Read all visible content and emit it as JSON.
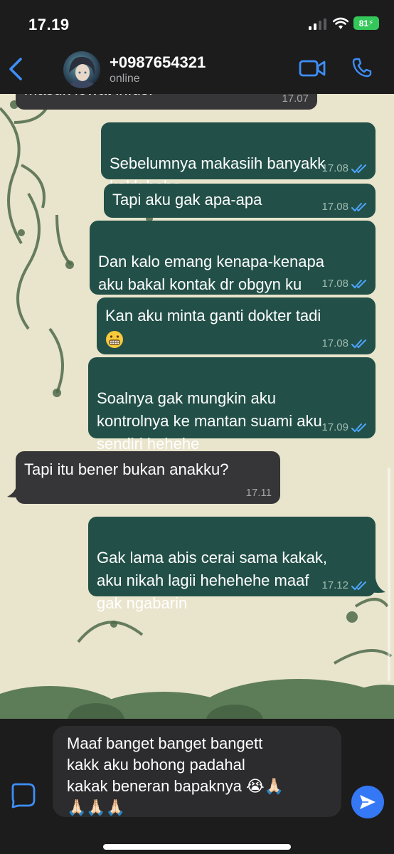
{
  "status_bar": {
    "time": "17.19",
    "battery": "81"
  },
  "header": {
    "contact_name": "+0987654321",
    "status": "online"
  },
  "messages": [
    {
      "direction": "incoming",
      "text": "masuk lewat infus.",
      "time": "17.07"
    },
    {
      "direction": "outgoing",
      "text": "Sebelumnya makasiih banyakk\nkakk hehe",
      "time": "17.08",
      "read": true
    },
    {
      "direction": "outgoing",
      "text": "Tapi aku gak apa-apa",
      "time": "17.08",
      "read": true
    },
    {
      "direction": "outgoing",
      "text": "Dan kalo emang kenapa-kenapa\naku bakal kontak dr obgyn ku",
      "time": "17.08",
      "read": true
    },
    {
      "direction": "outgoing",
      "text": "Kan aku minta ganti dokter tadi",
      "emoji": "grimacing-face",
      "time": "17.08",
      "read": true
    },
    {
      "direction": "outgoing",
      "text": "Soalnya gak mungkin aku\nkontrolnya ke mantan suami aku\nsendiri hehehe",
      "time": "17.09",
      "read": true
    },
    {
      "direction": "incoming",
      "text": "Tapi itu bener bukan anakku?",
      "time": "17.11"
    },
    {
      "direction": "outgoing",
      "text": "Gak lama abis cerai sama kakak,\naku nikah lagii hehehehe maaf\ngak ngabarin",
      "time": "17.12",
      "read": true
    }
  ],
  "composer": {
    "text": "Maaf banget banget bangett\nkakk aku bohong padahal\nkakak beneran bapaknya 😭🙏🏻\n🙏🏻🙏🏻🙏🏻"
  },
  "colors": {
    "outgoing_bubble": "#225048",
    "incoming_bubble": "#363638",
    "accent": "#3578f6",
    "wallpaper": "#e9e4cc"
  },
  "icons": [
    "back-icon",
    "video-call-icon",
    "phone-icon",
    "read-ticks-icon",
    "attach-icon",
    "send-icon",
    "signal-icon",
    "wifi-icon",
    "battery-icon"
  ]
}
